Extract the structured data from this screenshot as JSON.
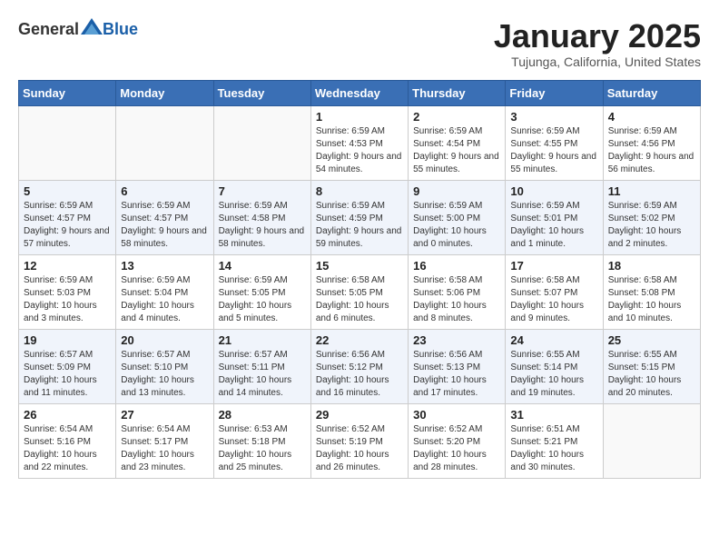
{
  "header": {
    "logo_general": "General",
    "logo_blue": "Blue",
    "month_title": "January 2025",
    "location": "Tujunga, California, United States"
  },
  "weekdays": [
    "Sunday",
    "Monday",
    "Tuesday",
    "Wednesday",
    "Thursday",
    "Friday",
    "Saturday"
  ],
  "weeks": [
    [
      {
        "day": "",
        "sunrise": "",
        "sunset": "",
        "daylight": ""
      },
      {
        "day": "",
        "sunrise": "",
        "sunset": "",
        "daylight": ""
      },
      {
        "day": "",
        "sunrise": "",
        "sunset": "",
        "daylight": ""
      },
      {
        "day": "1",
        "sunrise": "Sunrise: 6:59 AM",
        "sunset": "Sunset: 4:53 PM",
        "daylight": "Daylight: 9 hours and 54 minutes."
      },
      {
        "day": "2",
        "sunrise": "Sunrise: 6:59 AM",
        "sunset": "Sunset: 4:54 PM",
        "daylight": "Daylight: 9 hours and 55 minutes."
      },
      {
        "day": "3",
        "sunrise": "Sunrise: 6:59 AM",
        "sunset": "Sunset: 4:55 PM",
        "daylight": "Daylight: 9 hours and 55 minutes."
      },
      {
        "day": "4",
        "sunrise": "Sunrise: 6:59 AM",
        "sunset": "Sunset: 4:56 PM",
        "daylight": "Daylight: 9 hours and 56 minutes."
      }
    ],
    [
      {
        "day": "5",
        "sunrise": "Sunrise: 6:59 AM",
        "sunset": "Sunset: 4:57 PM",
        "daylight": "Daylight: 9 hours and 57 minutes."
      },
      {
        "day": "6",
        "sunrise": "Sunrise: 6:59 AM",
        "sunset": "Sunset: 4:57 PM",
        "daylight": "Daylight: 9 hours and 58 minutes."
      },
      {
        "day": "7",
        "sunrise": "Sunrise: 6:59 AM",
        "sunset": "Sunset: 4:58 PM",
        "daylight": "Daylight: 9 hours and 58 minutes."
      },
      {
        "day": "8",
        "sunrise": "Sunrise: 6:59 AM",
        "sunset": "Sunset: 4:59 PM",
        "daylight": "Daylight: 9 hours and 59 minutes."
      },
      {
        "day": "9",
        "sunrise": "Sunrise: 6:59 AM",
        "sunset": "Sunset: 5:00 PM",
        "daylight": "Daylight: 10 hours and 0 minutes."
      },
      {
        "day": "10",
        "sunrise": "Sunrise: 6:59 AM",
        "sunset": "Sunset: 5:01 PM",
        "daylight": "Daylight: 10 hours and 1 minute."
      },
      {
        "day": "11",
        "sunrise": "Sunrise: 6:59 AM",
        "sunset": "Sunset: 5:02 PM",
        "daylight": "Daylight: 10 hours and 2 minutes."
      }
    ],
    [
      {
        "day": "12",
        "sunrise": "Sunrise: 6:59 AM",
        "sunset": "Sunset: 5:03 PM",
        "daylight": "Daylight: 10 hours and 3 minutes."
      },
      {
        "day": "13",
        "sunrise": "Sunrise: 6:59 AM",
        "sunset": "Sunset: 5:04 PM",
        "daylight": "Daylight: 10 hours and 4 minutes."
      },
      {
        "day": "14",
        "sunrise": "Sunrise: 6:59 AM",
        "sunset": "Sunset: 5:05 PM",
        "daylight": "Daylight: 10 hours and 5 minutes."
      },
      {
        "day": "15",
        "sunrise": "Sunrise: 6:58 AM",
        "sunset": "Sunset: 5:05 PM",
        "daylight": "Daylight: 10 hours and 6 minutes."
      },
      {
        "day": "16",
        "sunrise": "Sunrise: 6:58 AM",
        "sunset": "Sunset: 5:06 PM",
        "daylight": "Daylight: 10 hours and 8 minutes."
      },
      {
        "day": "17",
        "sunrise": "Sunrise: 6:58 AM",
        "sunset": "Sunset: 5:07 PM",
        "daylight": "Daylight: 10 hours and 9 minutes."
      },
      {
        "day": "18",
        "sunrise": "Sunrise: 6:58 AM",
        "sunset": "Sunset: 5:08 PM",
        "daylight": "Daylight: 10 hours and 10 minutes."
      }
    ],
    [
      {
        "day": "19",
        "sunrise": "Sunrise: 6:57 AM",
        "sunset": "Sunset: 5:09 PM",
        "daylight": "Daylight: 10 hours and 11 minutes."
      },
      {
        "day": "20",
        "sunrise": "Sunrise: 6:57 AM",
        "sunset": "Sunset: 5:10 PM",
        "daylight": "Daylight: 10 hours and 13 minutes."
      },
      {
        "day": "21",
        "sunrise": "Sunrise: 6:57 AM",
        "sunset": "Sunset: 5:11 PM",
        "daylight": "Daylight: 10 hours and 14 minutes."
      },
      {
        "day": "22",
        "sunrise": "Sunrise: 6:56 AM",
        "sunset": "Sunset: 5:12 PM",
        "daylight": "Daylight: 10 hours and 16 minutes."
      },
      {
        "day": "23",
        "sunrise": "Sunrise: 6:56 AM",
        "sunset": "Sunset: 5:13 PM",
        "daylight": "Daylight: 10 hours and 17 minutes."
      },
      {
        "day": "24",
        "sunrise": "Sunrise: 6:55 AM",
        "sunset": "Sunset: 5:14 PM",
        "daylight": "Daylight: 10 hours and 19 minutes."
      },
      {
        "day": "25",
        "sunrise": "Sunrise: 6:55 AM",
        "sunset": "Sunset: 5:15 PM",
        "daylight": "Daylight: 10 hours and 20 minutes."
      }
    ],
    [
      {
        "day": "26",
        "sunrise": "Sunrise: 6:54 AM",
        "sunset": "Sunset: 5:16 PM",
        "daylight": "Daylight: 10 hours and 22 minutes."
      },
      {
        "day": "27",
        "sunrise": "Sunrise: 6:54 AM",
        "sunset": "Sunset: 5:17 PM",
        "daylight": "Daylight: 10 hours and 23 minutes."
      },
      {
        "day": "28",
        "sunrise": "Sunrise: 6:53 AM",
        "sunset": "Sunset: 5:18 PM",
        "daylight": "Daylight: 10 hours and 25 minutes."
      },
      {
        "day": "29",
        "sunrise": "Sunrise: 6:52 AM",
        "sunset": "Sunset: 5:19 PM",
        "daylight": "Daylight: 10 hours and 26 minutes."
      },
      {
        "day": "30",
        "sunrise": "Sunrise: 6:52 AM",
        "sunset": "Sunset: 5:20 PM",
        "daylight": "Daylight: 10 hours and 28 minutes."
      },
      {
        "day": "31",
        "sunrise": "Sunrise: 6:51 AM",
        "sunset": "Sunset: 5:21 PM",
        "daylight": "Daylight: 10 hours and 30 minutes."
      },
      {
        "day": "",
        "sunrise": "",
        "sunset": "",
        "daylight": ""
      }
    ]
  ]
}
